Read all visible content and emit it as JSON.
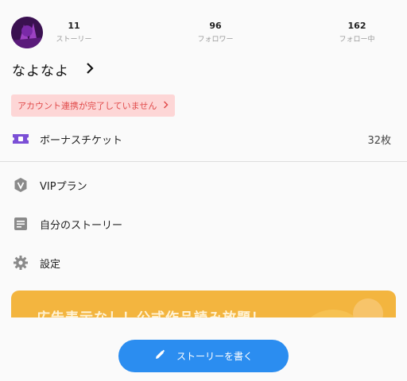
{
  "profile": {
    "username": "なよなよ",
    "stats": [
      {
        "value": "11",
        "label": "ストーリー"
      },
      {
        "value": "96",
        "label": "フォロワー"
      },
      {
        "value": "162",
        "label": "フォロー中"
      }
    ]
  },
  "warning": {
    "text": "アカウント連携が完了していません"
  },
  "menu": {
    "bonus_ticket": {
      "label": "ボーナスチケット",
      "value": "32枚",
      "icon": "ticket-icon",
      "color": "#7b4fd6"
    },
    "vip": {
      "label": "VIPプラン",
      "icon": "vip-badge-icon"
    },
    "my_stories": {
      "label": "自分のストーリー",
      "icon": "document-icon"
    },
    "settings": {
      "label": "設定",
      "icon": "gear-icon"
    }
  },
  "banner": {
    "text": "広告表示なし！公式作品読み放題！"
  },
  "fab": {
    "label": "ストーリーを書く",
    "icon": "pencil-icon",
    "color": "#2b8df0"
  }
}
